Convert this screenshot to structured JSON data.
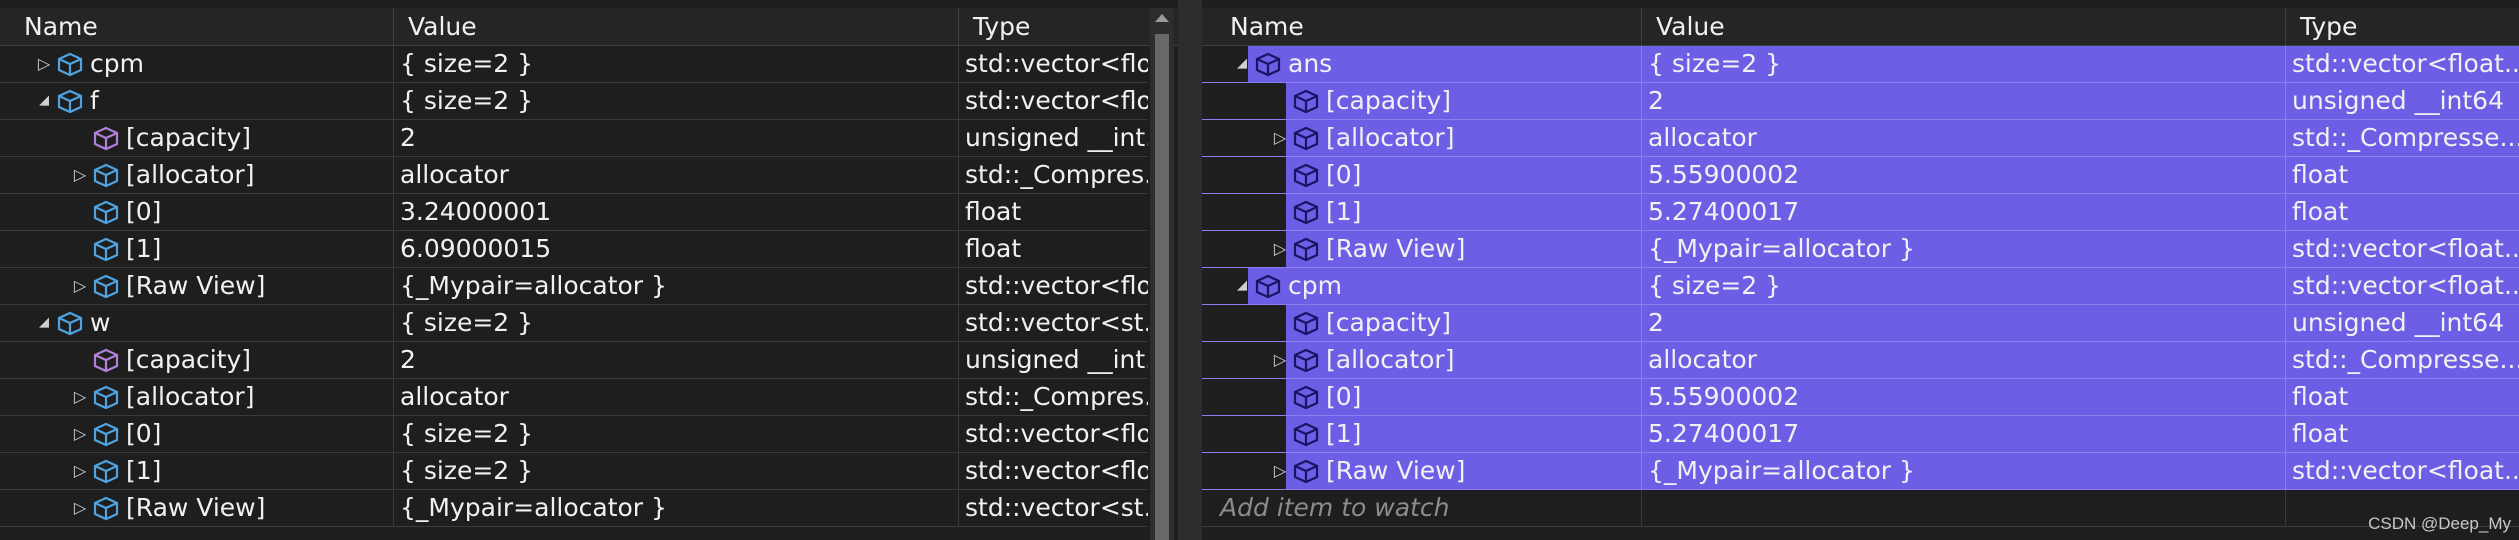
{
  "columns": {
    "name": "Name",
    "value": "Value",
    "type": "Type"
  },
  "left_panel": {
    "rows": [
      {
        "name": "cpm",
        "value": "{ size=2 }",
        "type": "std::vector<flo...",
        "depth": 0,
        "expander": "collapsed",
        "icon": "variable-icon"
      },
      {
        "name": "f",
        "value": "{ size=2 }",
        "type": "std::vector<flo...",
        "depth": 0,
        "expander": "expanded",
        "icon": "variable-icon"
      },
      {
        "name": "[capacity]",
        "value": "2",
        "type": "unsigned __int...",
        "depth": 1,
        "expander": "none",
        "icon": "property-icon"
      },
      {
        "name": "[allocator]",
        "value": "allocator",
        "type": "std::_Compres...",
        "depth": 1,
        "expander": "collapsed",
        "icon": "variable-icon"
      },
      {
        "name": "[0]",
        "value": "3.24000001",
        "type": "float",
        "depth": 1,
        "expander": "none",
        "icon": "variable-icon"
      },
      {
        "name": "[1]",
        "value": "6.09000015",
        "type": "float",
        "depth": 1,
        "expander": "none",
        "icon": "variable-icon"
      },
      {
        "name": "[Raw View]",
        "value": "{_Mypair=allocator }",
        "type": "std::vector<flo...",
        "depth": 1,
        "expander": "collapsed",
        "icon": "variable-icon"
      },
      {
        "name": "w",
        "value": "{ size=2 }",
        "type": "std::vector<st...",
        "depth": 0,
        "expander": "expanded",
        "icon": "variable-icon"
      },
      {
        "name": "[capacity]",
        "value": "2",
        "type": "unsigned __int...",
        "depth": 1,
        "expander": "none",
        "icon": "property-icon"
      },
      {
        "name": "[allocator]",
        "value": "allocator",
        "type": "std::_Compres...",
        "depth": 1,
        "expander": "collapsed",
        "icon": "variable-icon"
      },
      {
        "name": "[0]",
        "value": "{ size=2 }",
        "type": "std::vector<flo...",
        "depth": 1,
        "expander": "collapsed",
        "icon": "variable-icon"
      },
      {
        "name": "[1]",
        "value": "{ size=2 }",
        "type": "std::vector<flo...",
        "depth": 1,
        "expander": "collapsed",
        "icon": "variable-icon"
      },
      {
        "name": "[Raw View]",
        "value": "{_Mypair=allocator }",
        "type": "std::vector<st...",
        "depth": 1,
        "expander": "collapsed",
        "icon": "variable-icon"
      }
    ]
  },
  "right_panel": {
    "rows": [
      {
        "name": "ans",
        "value": "{ size=2 }",
        "type": "std::vector<float...",
        "depth": 0,
        "expander": "expanded",
        "icon": "variable-icon"
      },
      {
        "name": "[capacity]",
        "value": "2",
        "type": "unsigned __int64",
        "depth": 1,
        "expander": "none",
        "icon": "property-icon"
      },
      {
        "name": "[allocator]",
        "value": "allocator",
        "type": "std::_Compresse...",
        "depth": 1,
        "expander": "collapsed",
        "icon": "variable-icon"
      },
      {
        "name": "[0]",
        "value": "5.55900002",
        "type": "float",
        "depth": 1,
        "expander": "none",
        "icon": "variable-icon"
      },
      {
        "name": "[1]",
        "value": "5.27400017",
        "type": "float",
        "depth": 1,
        "expander": "none",
        "icon": "variable-icon"
      },
      {
        "name": "[Raw View]",
        "value": "{_Mypair=allocator }",
        "type": "std::vector<float...",
        "depth": 1,
        "expander": "collapsed",
        "icon": "variable-icon"
      },
      {
        "name": "cpm",
        "value": "{ size=2 }",
        "type": "std::vector<float...",
        "depth": 0,
        "expander": "expanded",
        "icon": "variable-icon"
      },
      {
        "name": "[capacity]",
        "value": "2",
        "type": "unsigned __int64",
        "depth": 1,
        "expander": "none",
        "icon": "property-icon"
      },
      {
        "name": "[allocator]",
        "value": "allocator",
        "type": "std::_Compresse...",
        "depth": 1,
        "expander": "collapsed",
        "icon": "variable-icon"
      },
      {
        "name": "[0]",
        "value": "5.55900002",
        "type": "float",
        "depth": 1,
        "expander": "none",
        "icon": "variable-icon"
      },
      {
        "name": "[1]",
        "value": "5.27400017",
        "type": "float",
        "depth": 1,
        "expander": "none",
        "icon": "variable-icon"
      },
      {
        "name": "[Raw View]",
        "value": "{_Mypair=allocator }",
        "type": "std::vector<float...",
        "depth": 1,
        "expander": "collapsed",
        "icon": "variable-icon"
      }
    ],
    "add_item_placeholder": "Add item to watch"
  },
  "watermark": "CSDN @Deep_My",
  "colors": {
    "background": "#1e1e1e",
    "header": "#252526",
    "selection": "#6d5ee6",
    "variable_icon": "#4fa3e0",
    "property_icon": "#b180d7"
  }
}
